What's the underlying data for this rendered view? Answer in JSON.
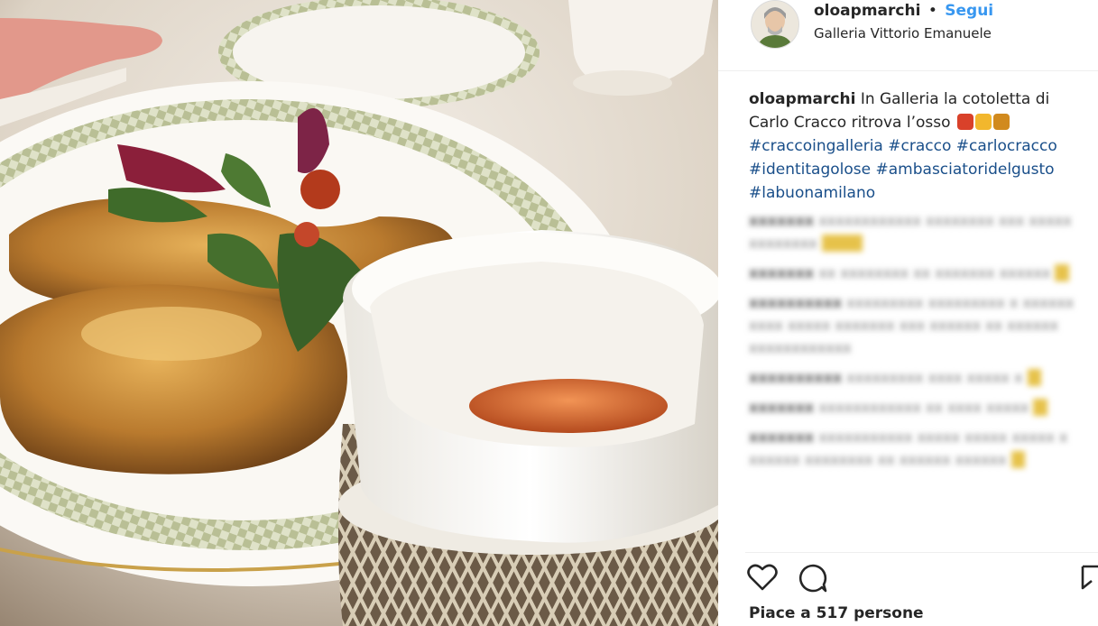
{
  "post": {
    "username": "oloapmarchi",
    "separator": "•",
    "follow_label": "Segui",
    "location": "Galleria Vittorio Emanuele"
  },
  "caption": {
    "username": "oloapmarchi",
    "text": "In Galleria la cotoletta di Carlo Cracco ritrova l’osso",
    "emojis": [
      "collision-emoji",
      "thumbs-up-emoji",
      "party-popper-emoji"
    ],
    "hashtags": [
      "#craccoingalleria",
      "#cracco",
      "#carlocracco",
      "#identitagolose",
      "#ambasciatoridelgusto",
      "#labuonamilano"
    ]
  },
  "comments_blurred": true,
  "likes": {
    "label": "Piace a 517 persone"
  },
  "icons": {
    "like": "heart-icon",
    "comment": "comment-icon",
    "share": "share-icon"
  },
  "colors": {
    "link": "#3897f0",
    "hashtag": "#003569",
    "text": "#262626"
  }
}
